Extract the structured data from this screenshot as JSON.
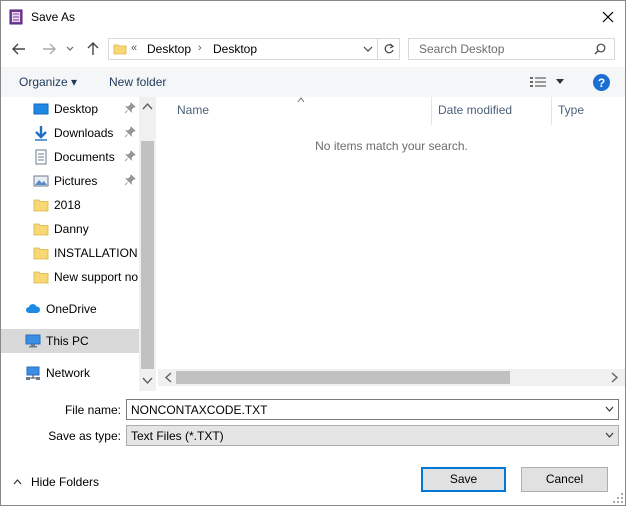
{
  "window": {
    "title": "Save As"
  },
  "address": {
    "overflow": "«",
    "segments": [
      "Desktop",
      "Desktop"
    ]
  },
  "search": {
    "placeholder": "Search Desktop"
  },
  "toolbar": {
    "organize_label": "Organize ▾",
    "new_folder_label": "New folder",
    "help_label": "?"
  },
  "sidebar": {
    "items": [
      {
        "label": "Desktop",
        "icon": "desktop-icon",
        "pinned": true
      },
      {
        "label": "Downloads",
        "icon": "download-arrow-icon",
        "pinned": true
      },
      {
        "label": "Documents",
        "icon": "document-icon",
        "pinned": true
      },
      {
        "label": "Pictures",
        "icon": "picture-icon",
        "pinned": true
      },
      {
        "label": "2018",
        "icon": "folder-icon",
        "pinned": false
      },
      {
        "label": "Danny",
        "icon": "folder-icon",
        "pinned": false
      },
      {
        "label": "INSTALLATION C",
        "icon": "folder-icon",
        "pinned": false
      },
      {
        "label": "New support no",
        "icon": "folder-icon",
        "pinned": false
      }
    ],
    "roots": [
      {
        "label": "OneDrive",
        "icon": "cloud-icon"
      },
      {
        "label": "This PC",
        "icon": "computer-icon",
        "selected": true
      },
      {
        "label": "Network",
        "icon": "network-icon"
      }
    ]
  },
  "filelist": {
    "columns": [
      "Name",
      "Date modified",
      "Type"
    ],
    "empty_message": "No items match your search."
  },
  "form": {
    "filename_label": "File name:",
    "filename_value": "NONCONTAXCODE.TXT",
    "savetype_label": "Save as type:",
    "savetype_value": "Text Files (*.TXT)"
  },
  "footer": {
    "hide_folders_label": "Hide Folders",
    "save_label": "Save",
    "cancel_label": "Cancel"
  },
  "colors": {
    "folder": "#f8d775",
    "accent": "#0078d7",
    "help": "#1a6fd1",
    "selected_row": "#d9d9d9"
  }
}
